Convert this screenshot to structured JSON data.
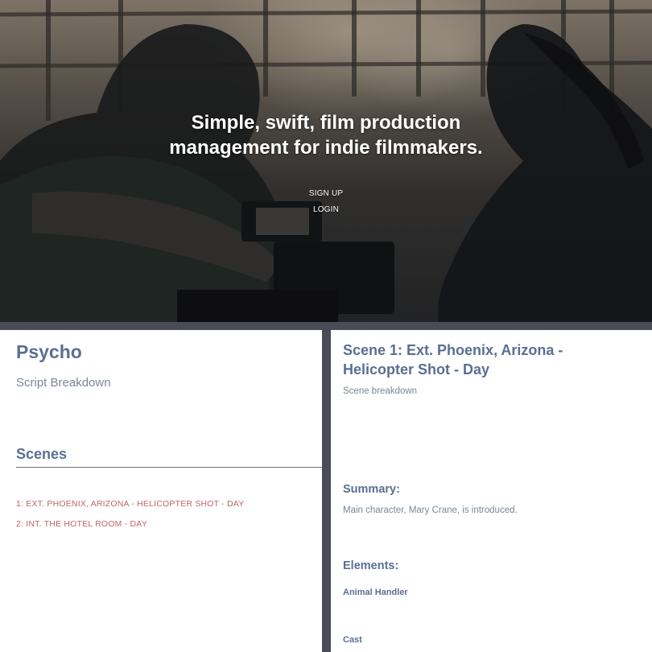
{
  "hero": {
    "headline": "Simple, swift, film production management for indie filmmakers.",
    "signup_label": "SIGN UP",
    "login_label": "LOGIN"
  },
  "script_breakdown": {
    "project_title": "Psycho",
    "subtitle": "Script Breakdown",
    "scenes_heading": "Scenes",
    "scenes": [
      "1: EXT. PHOENIX, ARIZONA - HELICOPTER SHOT - DAY",
      "2: INT. THE HOTEL ROOM - DAY"
    ]
  },
  "scene_detail": {
    "title": "Scene 1: Ext. Phoenix, Arizona - Helicopter Shot - Day",
    "subtitle": "Scene breakdown",
    "summary_heading": "Summary:",
    "summary_text": "Main character, Mary Crane, is introduced.",
    "elements_heading": "Elements:",
    "elements": [
      "Animal Handler",
      "Cast"
    ]
  },
  "colors": {
    "heading": "#5a6f93",
    "muted_text": "#7b8698",
    "scene_link": "#c06565",
    "divider": "#4a4b55"
  }
}
